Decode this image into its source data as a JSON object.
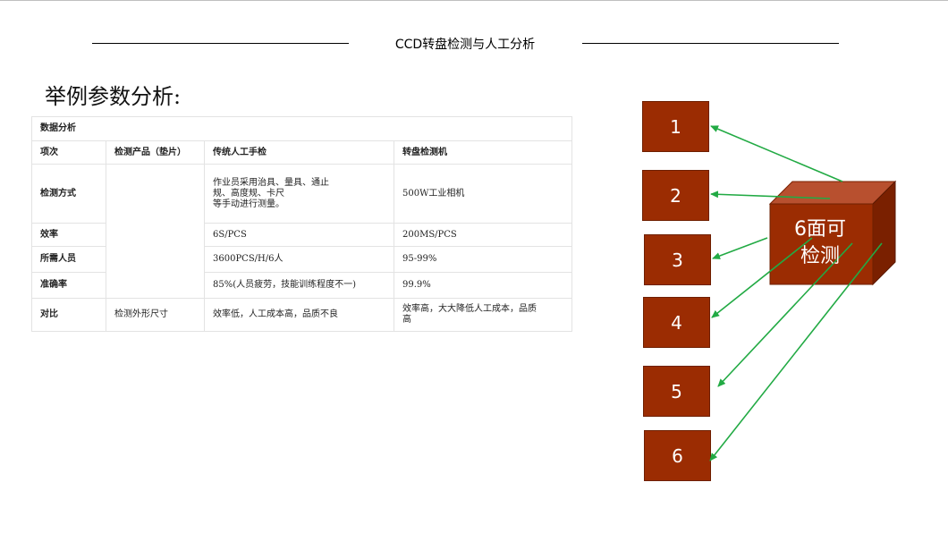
{
  "header": {
    "title": "CCD转盘检测与人工分析"
  },
  "section": {
    "heading": "举例参数分析:"
  },
  "table": {
    "caption": "数据分析",
    "headers": [
      "项次",
      "检测产品（垫片）",
      "传统人工手检",
      "转盘检测机"
    ],
    "rows": {
      "method": {
        "label": "检测方式",
        "manual_line1": "作业员采用治具、量具、通止",
        "manual_line2": "规、高度规、卡尺",
        "manual_line3": "等手动进行测量。",
        "machine": "500W工业相机"
      },
      "efficiency": {
        "label": "效率",
        "manual": "6S/PCS",
        "machine": "200MS/PCS"
      },
      "staff": {
        "label": "所需人员",
        "manual": "3600PCS/H/6人",
        "machine": "95-99%"
      },
      "accuracy": {
        "label": "准确率",
        "manual": "85%(人员疲劳，技能训练程度不一)",
        "machine": "99.9%"
      },
      "compare": {
        "label": "对比",
        "product": "检测外形尺寸",
        "manual": "效率低，人工成本高，品质不良",
        "machine_line1": "效率高，大大降低人工成本，品质",
        "machine_line2": "高"
      }
    }
  },
  "diagram": {
    "boxes": [
      "1",
      "2",
      "3",
      "4",
      "5",
      "6"
    ],
    "cube_line1": "6面可",
    "cube_line2": "检测",
    "colors": {
      "box": "#9b2c02",
      "cube_front": "#9b2c02",
      "cube_top": "#b8502f",
      "cube_side": "#7a2000",
      "arrow": "#22aa44"
    }
  }
}
